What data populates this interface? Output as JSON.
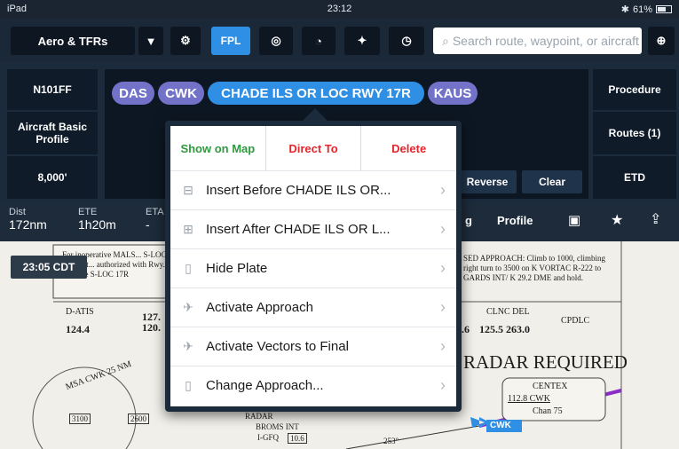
{
  "status": {
    "device": "iPad",
    "time": "23:12",
    "battery": "61%"
  },
  "toolbar": {
    "map_layer": "Aero & TFRs",
    "fpl_label": "FPL",
    "search_placeholder": "Search route, waypoint, or aircraft"
  },
  "aircraft": {
    "tail": "N101FF",
    "profile": "Aircraft Basic Profile",
    "altitude": "8,000'"
  },
  "route": {
    "waypoints": [
      "DAS",
      "CWK",
      "CHADE ILS OR LOC RWY 17R",
      "KAUS"
    ],
    "reverse_label": "Reverse",
    "clear_label": "Clear"
  },
  "right_buttons": {
    "procedure": "Procedure",
    "routes": "Routes (1)",
    "etd": "ETD"
  },
  "info": {
    "dist_label": "Dist",
    "dist_value": "172nm",
    "ete_label": "ETE",
    "ete_value": "1h20m",
    "eta_label": "ETA",
    "eta_value": "-",
    "g_label": "g",
    "profile_label": "Profile"
  },
  "time_badge": "23:05 CDT",
  "popover": {
    "actions": {
      "show_on_map": "Show on Map",
      "direct_to": "Direct To",
      "delete": "Delete"
    },
    "items": [
      {
        "label": "Insert Before CHADE ILS OR...",
        "icon": "insert-before-icon"
      },
      {
        "label": "Insert After CHADE ILS OR L...",
        "icon": "insert-after-icon"
      },
      {
        "label": "Hide Plate",
        "icon": "plate-icon"
      },
      {
        "label": "Activate Approach",
        "icon": "activate-icon"
      },
      {
        "label": "Activate Vectors to Final",
        "icon": "vectors-icon"
      },
      {
        "label": "Change Approach...",
        "icon": "change-approach-icon"
      }
    ]
  },
  "chart": {
    "inop_note": "For inoperative MALS... S-LOC 17R Cat... authorized with Rwy... increase S-LOC 17R",
    "d_atis_label": "D-ATIS",
    "d_atis_freq": "124.4",
    "freq_a": "127.",
    "freq_b": "120.",
    "missed_approach": "SED APPROACH: Climb to 1000, climbing right turn to 3500 on K VORTAC R-222 to GARDS INT/ K 29.2 DME and hold.",
    "clnc_del_label": "CLNC DEL",
    "clnc_del_freq": "125.5 263.0",
    "freq_prefix": ".6",
    "cpdlc": "CPDLC",
    "radar_required": "RADAR REQUIRED",
    "msa": "MSA CWK 25 NM",
    "centex": "CENTEX",
    "centex_freq": "112.8 CWK",
    "centex_chan": "Chan 75",
    "alt_3100": "3100",
    "alt_2600": "2600",
    "radar": "RADAR",
    "broms": "BROMS INT",
    "ifgq": "I-GFQ",
    "ifgq_dme": "10.6",
    "radial_253": "253°",
    "cwk_label": "CWK"
  },
  "colors": {
    "accent": "#2f8fe4",
    "waypoint": "#7273c8",
    "green": "#2e9a3e",
    "red": "#e2262c"
  }
}
